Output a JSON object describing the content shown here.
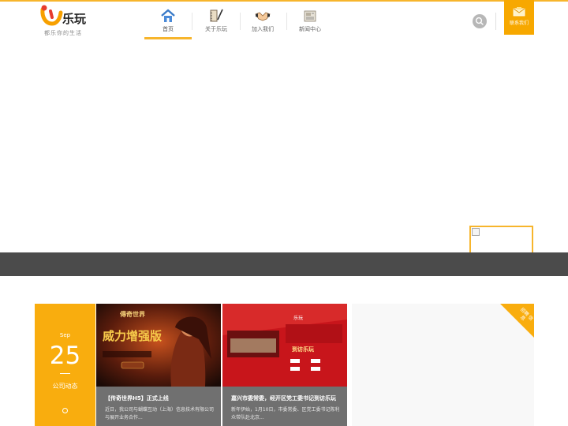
{
  "logo": {
    "brand": "乐玩",
    "slogan": "都乐你的生活"
  },
  "nav": [
    {
      "label": "首页",
      "icon": "home-icon",
      "active": true
    },
    {
      "label": "关于乐玩",
      "icon": "book-pen-icon",
      "active": false
    },
    {
      "label": "加入我们",
      "icon": "handshake-icon",
      "active": false
    },
    {
      "label": "新闻中心",
      "icon": "newspaper-icon",
      "active": false
    }
  ],
  "header": {
    "search_icon": "search-icon",
    "contact_label": "联系我们"
  },
  "colors": {
    "accent": "#f7b52c",
    "band": "#4b4b4b",
    "card_gray": "#707070"
  },
  "news": {
    "date": {
      "month": "Sep",
      "day": "25",
      "category": "公司动态"
    },
    "items": [
      {
        "title": "【传奇世界H5】正式上线",
        "summary": "近日，我公司与蝴蝶互动（上海）信息技术有限公司与展开业务合作...",
        "thumb_text": "威力增强版"
      },
      {
        "title": "嘉兴市委常委，经开区党工委书记到访乐玩",
        "summary": "新年伊始，1月10日，市委常委、区党工委书记陈利众带队赴北京...",
        "thumb_text": "到访乐玩"
      }
    ],
    "corner_badge": "招聘 信息"
  }
}
